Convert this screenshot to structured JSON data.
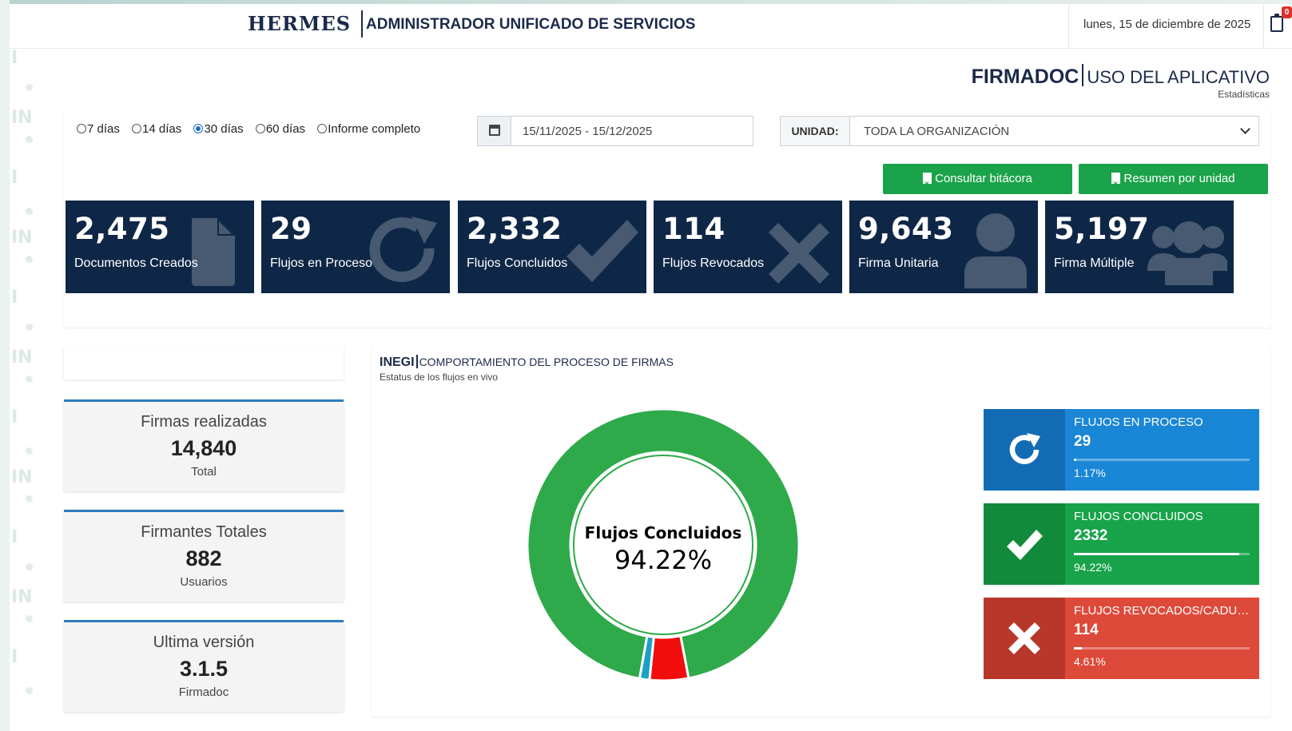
{
  "header": {
    "brand": "HERMES",
    "subtitle": "ADMINISTRADOR UNIFICADO DE SERVICIOS",
    "date": "lunes, 15 de diciembre de 2025",
    "notification_count": "0",
    "notification_icon": "clipboard-icon"
  },
  "page": {
    "title_main": "FIRMADOC",
    "title_rest": "USO DEL APLICATIVO",
    "subtitle": "Estadísticas"
  },
  "filters": {
    "periods": [
      "7 días",
      "14 días",
      "30 días",
      "60 días",
      "Informe completo"
    ],
    "selected_period": "30 días",
    "date_range": "15/11/2025 - 15/12/2025",
    "unidad_label": "UNIDAD:",
    "unidad_value": "TODA LA ORGANIZACIÓN"
  },
  "actions": {
    "bitacora": "Consultar bitácora",
    "resumen": "Resumen por unidad"
  },
  "kpis": [
    {
      "value": "2,475",
      "label": "Documentos Creados",
      "icon": "document-icon"
    },
    {
      "value": "29",
      "label": "Flujos en Proceso",
      "icon": "refresh-icon"
    },
    {
      "value": "2,332",
      "label": "Flujos Concluidos",
      "icon": "check-icon"
    },
    {
      "value": "114",
      "label": "Flujos Revocados",
      "icon": "x-icon"
    },
    {
      "value": "9,643",
      "label": "Firma Unitaria",
      "icon": "user-icon"
    },
    {
      "value": "5,197",
      "label": "Firma Múltiple",
      "icon": "users-icon"
    }
  ],
  "stats": [
    {
      "title": "Firmas realizadas",
      "value": "14,840",
      "sub": "Total"
    },
    {
      "title": "Firmantes Totales",
      "value": "882",
      "sub": "Usuarios"
    },
    {
      "title": "Ultima versión",
      "value": "3.1.5",
      "sub": "Firmadoc"
    }
  ],
  "chart_panel": {
    "title_a": "INEGI",
    "title_b": "COMPORTAMIENTO DEL PROCESO DE FIRMAS",
    "subtitle": "Estatus de los flujos en vivo"
  },
  "chart_data": {
    "type": "pie",
    "variant": "donut",
    "center_label": "Flujos Concluidos",
    "center_value": "94.22%",
    "slices": [
      {
        "label": "Flujos Concluidos",
        "value": 2332,
        "percent": 94.22,
        "color": "#2eaa4a"
      },
      {
        "label": "Flujos Revocados",
        "value": 114,
        "percent": 4.61,
        "color": "#f20d0d"
      },
      {
        "label": "Flujos en Proceso",
        "value": 29,
        "percent": 1.17,
        "color": "#1aa0c4"
      }
    ]
  },
  "cards": [
    {
      "title": "FLUJOS EN PROCESO",
      "value": "29",
      "percent_label": "1.17%",
      "fraction": 0.0117,
      "color": "#1a86d6",
      "icon_bg": "#136bb4",
      "icon": "refresh-icon"
    },
    {
      "title": "FLUJOS CONCLUIDOS",
      "value": "2332",
      "percent_label": "94.22%",
      "fraction": 0.9422,
      "color": "#18a34a",
      "icon_bg": "#128a3b",
      "icon": "check-icon"
    },
    {
      "title": "FLUJOS REVOCADOS/CADUC...",
      "value": "114",
      "percent_label": "4.61%",
      "fraction": 0.0461,
      "color": "#dd4a3a",
      "icon_bg": "#b7372a",
      "icon": "x-icon"
    }
  ]
}
